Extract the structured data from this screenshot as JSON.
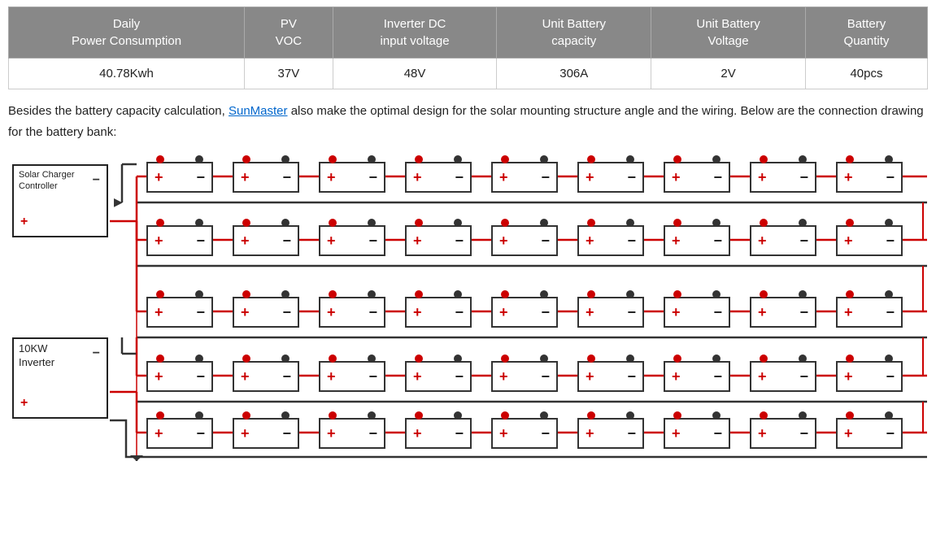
{
  "table": {
    "headers": [
      {
        "id": "daily-power",
        "line1": "Daily",
        "line2": "Power Consumption"
      },
      {
        "id": "pv-voc",
        "line1": "PV",
        "line2": "VOC"
      },
      {
        "id": "inverter-dc",
        "line1": "Inverter DC",
        "line2": "input voltage"
      },
      {
        "id": "unit-battery-capacity",
        "line1": "Unit Battery",
        "line2": "capacity"
      },
      {
        "id": "unit-battery-voltage",
        "line1": "Unit Battery",
        "line2": "Voltage"
      },
      {
        "id": "battery-quantity",
        "line1": "Battery",
        "line2": "Quantity"
      }
    ],
    "row": {
      "daily_power": "40.78Kwh",
      "pv_voc": "37V",
      "inverter_dc": "48V",
      "unit_battery_capacity": "306A",
      "unit_battery_voltage": "2V",
      "battery_quantity": "40pcs"
    }
  },
  "description": {
    "text_before": "Besides the battery capacity calculation, ",
    "brand": "SunMaster",
    "text_after": " also make the optimal design for the solar mounting structure angle and the wiring. Below are the connection drawing for the battery bank:"
  },
  "diagram": {
    "charger_controller": {
      "label_line1": "Solar Charger",
      "label_line2": "Controller"
    },
    "inverter": {
      "label_line1": "10KW",
      "label_line2": "Inverter"
    },
    "plus_symbol": "+",
    "minus_symbol": "−"
  }
}
